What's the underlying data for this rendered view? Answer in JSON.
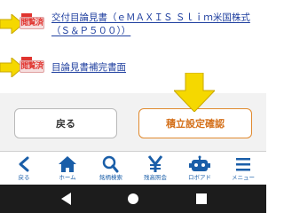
{
  "documents": [
    {
      "stamp": "閲覧済",
      "title": "交付目論見書（ｅＭＡＸＩＳ Ｓｌｉｍ米国株式（Ｓ＆Ｐ５００））"
    },
    {
      "stamp": "閲覧済",
      "title": "目論見書補完書面"
    }
  ],
  "actions": {
    "back_label": "戻る",
    "confirm_label": "積立設定確認"
  },
  "bottom_nav": [
    {
      "label": "戻る",
      "icon": "chevron-left-icon"
    },
    {
      "label": "ホーム",
      "icon": "home-icon"
    },
    {
      "label": "銘柄検索",
      "icon": "search-icon"
    },
    {
      "label": "残高照会",
      "icon": "yen-icon"
    },
    {
      "label": "ロボアド",
      "icon": "robot-icon"
    },
    {
      "label": "メニュー",
      "icon": "hamburger-menu-icon"
    }
  ],
  "colors": {
    "link": "#1f3f9f",
    "stamp": "#e0342f",
    "arrow": "#f5d800",
    "confirm": "#d4701a",
    "nav": "#1a5ea8"
  }
}
